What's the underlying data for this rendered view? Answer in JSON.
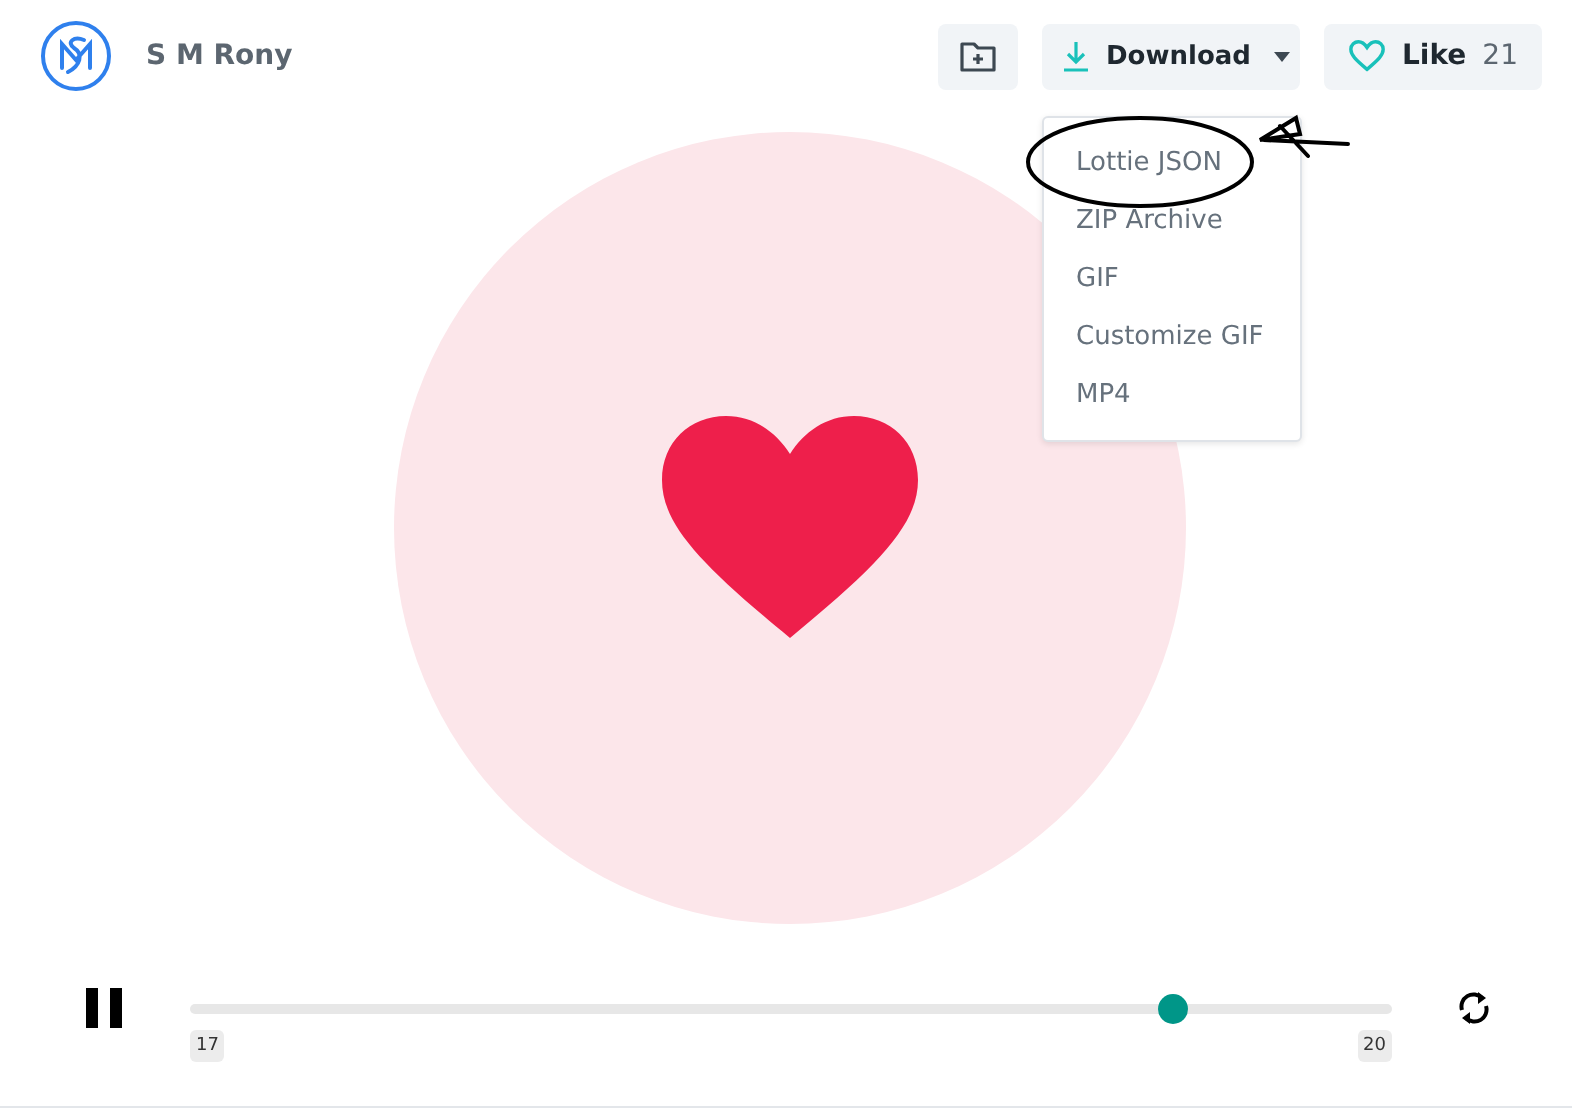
{
  "author": {
    "name": "S M Rony"
  },
  "actions": {
    "download": {
      "label": "Download",
      "expanded": true
    },
    "like": {
      "label": "Like",
      "count": "21"
    }
  },
  "download_menu": [
    "Lottie JSON",
    "ZIP Archive",
    "GIF",
    "Customize GIF",
    "MP4"
  ],
  "player": {
    "playing": true,
    "level": 0.817,
    "start_label": "17",
    "end_label": "20"
  }
}
